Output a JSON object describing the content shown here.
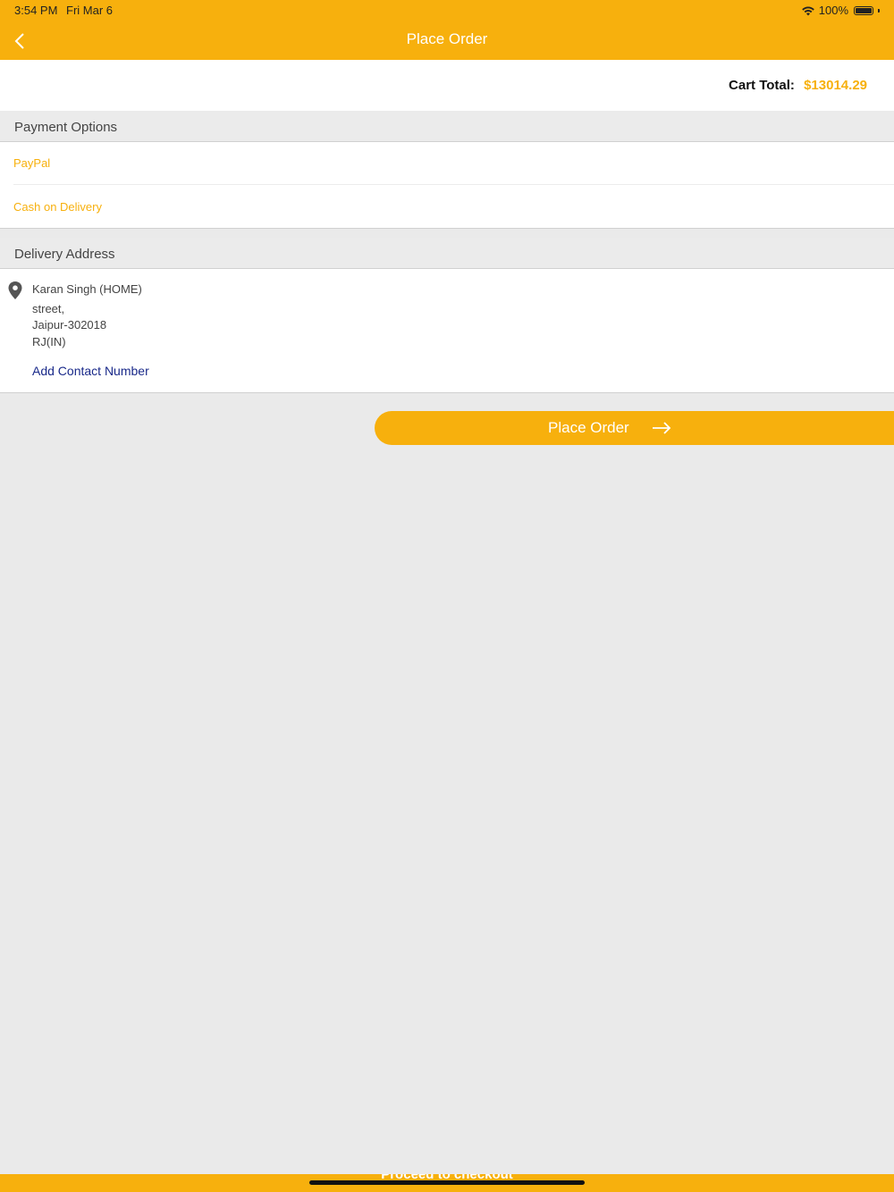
{
  "status_bar": {
    "time": "3:54 PM",
    "date": "Fri Mar 6",
    "battery_text": "100%"
  },
  "nav": {
    "title": "Place Order",
    "back_icon": "chevron-left-icon"
  },
  "cart": {
    "label": "Cart Total:",
    "value": "$13014.29"
  },
  "payment": {
    "header": "Payment Options",
    "options": [
      "PayPal",
      "Cash on Delivery"
    ]
  },
  "delivery": {
    "header": "Delivery Address",
    "icon": "location-pin-icon",
    "lines": [
      "Karan Singh (HOME)",
      "street,",
      "Jaipur-302018",
      "RJ(IN)"
    ],
    "add_contact_label": "Add Contact Number"
  },
  "place_order": {
    "label": "Place Order",
    "icon": "arrow-right-icon"
  },
  "bottom_bar": {
    "label": "Proceed to checkout"
  },
  "colors": {
    "accent": "#f7b00d",
    "link": "#1a2a8a",
    "background": "#eaeaea"
  }
}
